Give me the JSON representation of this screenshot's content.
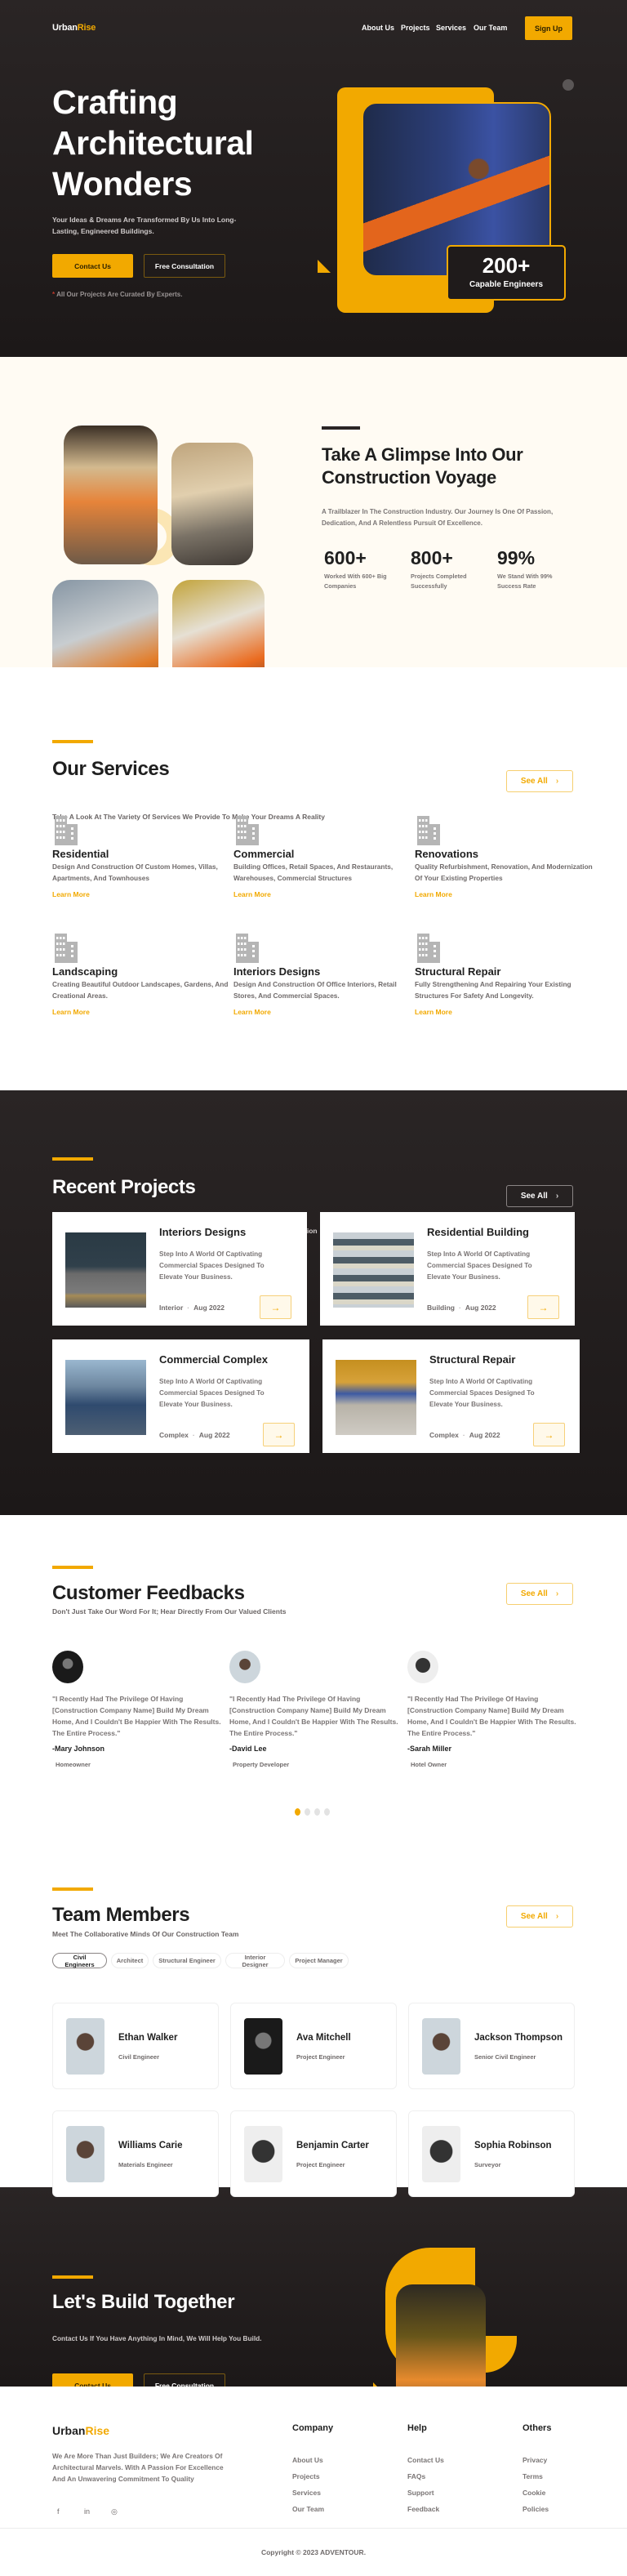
{
  "brand": {
    "name_part1": "Urban",
    "name_part2": "Rise",
    "accent_color": "#f2a900",
    "dark_bg": "#221e1e"
  },
  "nav": {
    "links": [
      "About Us",
      "Projects",
      "Services",
      "Our Team"
    ],
    "signup_label": "Sign Up"
  },
  "hero": {
    "title_lines": [
      "Crafting",
      "Architectural",
      "Wonders"
    ],
    "subtitle": "Your Ideas & Dreams Are Transformed By Us Into Long-Lasting, Engineered Buildings.",
    "contact_label": "Contact Us",
    "consult_label": "Free Consultation",
    "note_star": "*",
    "note": "All Our Projects Are Curated By Experts.",
    "badge_number": "200+",
    "badge_label": "Capable Engineers"
  },
  "about": {
    "title": "Take A Glimpse Into Our Construction Voyage",
    "description": "A Trailblazer In The Construction Industry. Our Journey Is One Of Passion, Dedication, And A Relentless Pursuit Of Excellence.",
    "stats": [
      {
        "value": "600+",
        "label": "Worked With 600+ Big Companies"
      },
      {
        "value": "800+",
        "label": "Projects Completed Successfully"
      },
      {
        "value": "99%",
        "label": "We Stand With 99% Success Rate"
      }
    ]
  },
  "services": {
    "title": "Our Services",
    "subtitle": "Take A Look At The Variety Of Services We Provide To Make Your Dreams A Reality",
    "see_all": "See All",
    "items": [
      {
        "icon": "building-icon",
        "title": "Residential",
        "desc": "Design And Construction Of Custom Homes, Villas, Apartments, And Townhouses",
        "link": "Learn More"
      },
      {
        "icon": "building-icon",
        "title": "Commercial",
        "desc": "Building Offices, Retail Spaces, And Restaurants, Warehouses, Commercial Structures",
        "link": "Learn More"
      },
      {
        "icon": "building-icon",
        "title": "Renovations",
        "desc": "Quality Refurbishment, Renovation, And Modernization Of Your  Existing Properties",
        "link": "Learn More"
      },
      {
        "icon": "building-icon",
        "title": "Landscaping",
        "desc": "Creating Beautiful Outdoor Landscapes, Gardens, And Creational Areas.",
        "link": "Learn More"
      },
      {
        "icon": "building-icon",
        "title": "Interiors Designs",
        "desc": "Design And Construction Of Office Interiors, Retail Stores, And Commercial Spaces.",
        "link": "Learn More"
      },
      {
        "icon": "building-icon",
        "title": "Structural Repair",
        "desc": "Fully Strengthening And Repairing Your Existing Structures For Safety And Longevity.",
        "link": "Learn More"
      }
    ]
  },
  "projects": {
    "title": "Recent Projects",
    "subtitle": "Recent Projects Showcasing Our Craftsmanship And Innovation In Construction",
    "see_all": "See All",
    "items": [
      {
        "title": "Interiors Designs",
        "desc": "Step Into A World Of Captivating Commercial Spaces Designed To Elevate Your Business.",
        "category": "Interior",
        "date": "Aug 2022"
      },
      {
        "title": "Residential Building",
        "desc": "Step Into A World Of Captivating Commercial Spaces Designed To Elevate Your Business.",
        "category": "Building",
        "date": "Aug 2022"
      },
      {
        "title": "Commercial Complex",
        "desc": "Step Into A World Of Captivating Commercial Spaces Designed To Elevate Your Business.",
        "category": "Complex",
        "date": "Aug 2022"
      },
      {
        "title": "Structural Repair",
        "desc": "Step Into A World Of Captivating Commercial Spaces Designed To Elevate Your Business.",
        "category": "Complex",
        "date": "Aug 2022"
      }
    ],
    "meta_separator": "·",
    "arrow_glyph": "→"
  },
  "feedbacks": {
    "title": "Customer Feedbacks",
    "subtitle": "Don't Just Take Our Word For It; Hear Directly From Our Valued Clients",
    "see_all": "See All",
    "items": [
      {
        "quote": "\"I Recently Had The Privilege Of Having [Construction Company Name] Build My Dream Home, And I Couldn't Be Happier With The Results. The Entire Process.\"",
        "name": "-Mary Johnson",
        "role": "Homeowner"
      },
      {
        "quote": "\"I Recently Had The Privilege Of Having [Construction Company Name] Build My Dream Home, And I Couldn't Be Happier With The Results. The Entire Process.\"",
        "name": "-David Lee",
        "role": "Property Developer"
      },
      {
        "quote": "\"I Recently Had The Privilege Of Having [Construction Company Name] Build My Dream Home, And I Couldn't Be Happier With The Results. The Entire Process.\"",
        "name": "-Sarah Miller",
        "role": "Hotel Owner"
      }
    ],
    "carousel_pages": 4,
    "carousel_active": 1
  },
  "team": {
    "title": "Team Members",
    "subtitle": "Meet The Collaborative Minds Of Our Construction Team",
    "see_all": "See All",
    "filters": [
      "Civil Engineers",
      "Architect",
      "Structural Engineer",
      "Interior Designer",
      "Project Manager"
    ],
    "active_filter": "Civil Engineers",
    "members": [
      {
        "name": "Ethan Walker",
        "role": "Civil Engineer"
      },
      {
        "name": "Ava Mitchell",
        "role": "Project Engineer"
      },
      {
        "name": "Jackson Thompson",
        "role": "Senior Civil Engineer"
      },
      {
        "name": "Williams Carie",
        "role": "Materials Engineer"
      },
      {
        "name": "Benjamin Carter",
        "role": "Project Engineer"
      },
      {
        "name": "Sophia Robinson",
        "role": "Surveyor"
      }
    ]
  },
  "cta": {
    "title": "Let's Build Together",
    "subtitle": "Contact Us If You Have Anything In Mind, We Will Help You Build.",
    "contact_label": "Contact Us",
    "consult_label": "Free Consultation"
  },
  "footer": {
    "about": "We Are More Than Just Builders; We Are Creators Of Architectural Marvels. With A Passion For Excellence And An Unwavering Commitment To Quality",
    "social": [
      {
        "icon": "facebook-icon",
        "glyph": "f"
      },
      {
        "icon": "linkedin-icon",
        "glyph": "in"
      },
      {
        "icon": "instagram-icon",
        "glyph": "◎"
      }
    ],
    "columns": [
      {
        "title": "Company",
        "links": [
          "About Us",
          "Projects",
          "Services",
          "Our Team"
        ]
      },
      {
        "title": "Help",
        "links": [
          "Contact Us",
          "FAQs",
          "Support",
          "Feedback"
        ]
      },
      {
        "title": "Others",
        "links": [
          "Privacy",
          "Terms",
          "Cookie",
          "Policies"
        ]
      }
    ],
    "copyright": "Copyright © 2023 ADVENTOUR."
  }
}
